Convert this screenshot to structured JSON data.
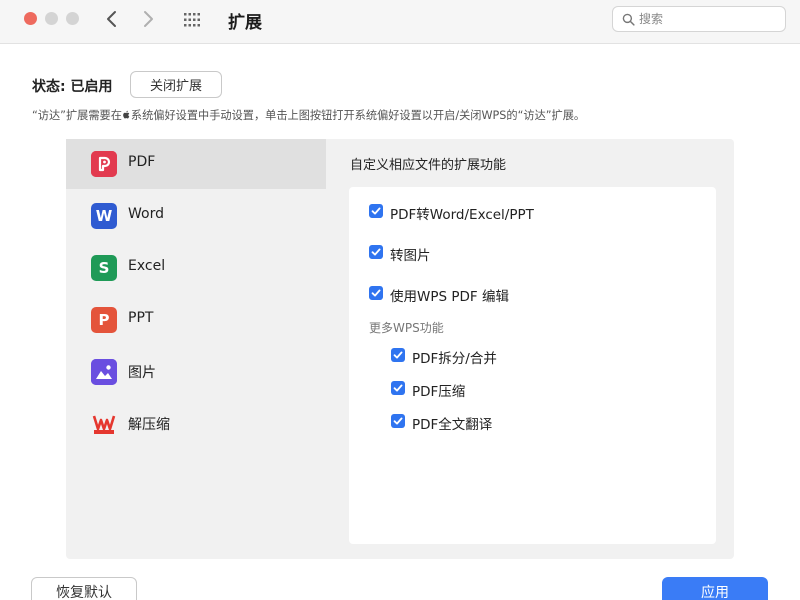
{
  "window": {
    "title": "扩展"
  },
  "search": {
    "placeholder": "搜索",
    "value": ""
  },
  "status": {
    "label": "状态: 已启用",
    "toggle_button": "关闭扩展"
  },
  "note": {
    "before_icon": "“访达”扩展需要在",
    "after_icon": "系统偏好设置中手动设置，单击上图按钮打开系统偏好设置以开启/关闭WPS的“访达”扩展。"
  },
  "sidebar": {
    "items": [
      {
        "label": "PDF",
        "icon": "pdf-icon",
        "color": "#e23a4f",
        "selected": true
      },
      {
        "label": "Word",
        "icon": "word-icon",
        "color": "#2f5bd1",
        "selected": false
      },
      {
        "label": "Excel",
        "icon": "excel-icon",
        "color": "#1f9a57",
        "selected": false
      },
      {
        "label": "PPT",
        "icon": "ppt-icon",
        "color": "#e4543b",
        "selected": false
      },
      {
        "label": "图片",
        "icon": "image-icon",
        "color": "#6a4ee0",
        "selected": false
      },
      {
        "label": "解压缩",
        "icon": "wps-unzip-icon",
        "color": "#e5372f",
        "selected": false
      }
    ]
  },
  "content": {
    "header": "自定义相应文件的扩展功能",
    "options": [
      {
        "label": "PDF转Word/Excel/PPT",
        "checked": true
      },
      {
        "label": "转图片",
        "checked": true
      },
      {
        "label": "使用WPS PDF 编辑",
        "checked": true
      }
    ],
    "more_header": "更多WPS功能",
    "more_options": [
      {
        "label": "PDF拆分/合并",
        "checked": true
      },
      {
        "label": "PDF压缩",
        "checked": true
      },
      {
        "label": "PDF全文翻译",
        "checked": true
      }
    ]
  },
  "footer": {
    "restore_button": "恢复默认",
    "apply_button": "应用"
  },
  "colors": {
    "accent": "#3a7cf6",
    "checkbox": "#2f74f0",
    "close_light": "#ee6a5e"
  }
}
